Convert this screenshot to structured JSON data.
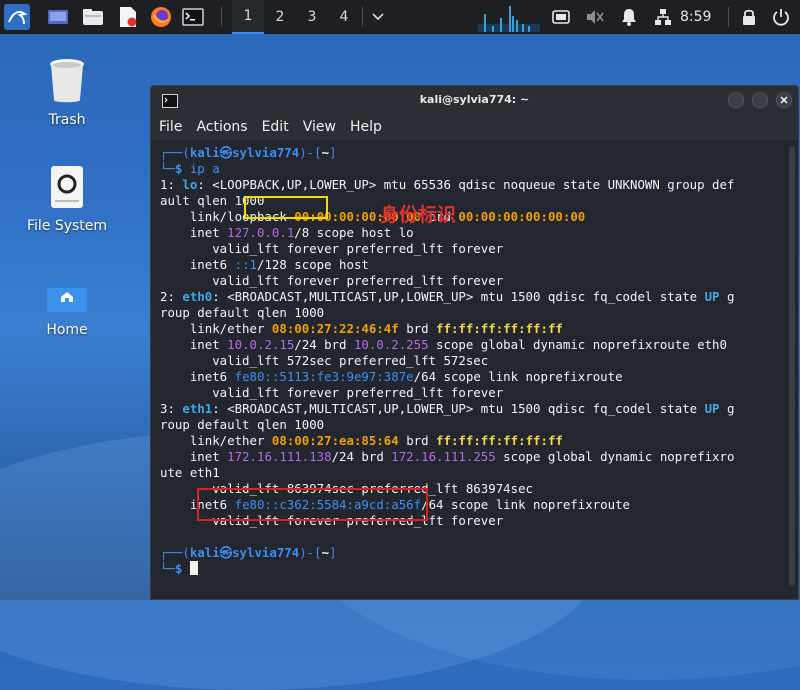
{
  "panel": {
    "workspaces": [
      "1",
      "2",
      "3",
      "4"
    ],
    "clock": "8:59"
  },
  "desktop": {
    "icons": [
      {
        "label": "Trash"
      },
      {
        "label": "File System"
      },
      {
        "label": "Home"
      }
    ]
  },
  "terminal": {
    "title": "kali@sylvia774: ~",
    "menu": [
      "File",
      "Actions",
      "Edit",
      "View",
      "Help"
    ],
    "annotation": "身份标识",
    "prompt_user": "kali",
    "prompt_host": "sylvia774",
    "prompt_dir": "~",
    "command": "ip a",
    "lines": [
      "1: lo: <LOOPBACK,UP,LOWER_UP> mtu 65536 qdisc noqueue state UNKNOWN group def",
      "ault qlen 1000",
      "    link/loopback 00:00:00:00:00:00 brd 00:00:00:00:00:00",
      "    inet 127.0.0.1/8 scope host lo",
      "       valid_lft forever preferred_lft forever",
      "    inet6 ::1/128 scope host",
      "       valid_lft forever preferred_lft forever",
      "2: eth0: <BROADCAST,MULTICAST,UP,LOWER_UP> mtu 1500 qdisc fq_codel state UP g",
      "roup default qlen 1000",
      "    link/ether 08:00:27:22:46:4f brd ff:ff:ff:ff:ff:ff",
      "    inet 10.0.2.15/24 brd 10.0.2.255 scope global dynamic noprefixroute eth0",
      "       valid_lft 572sec preferred_lft 572sec",
      "    inet6 fe80::5113:fe3:9e97:387e/64 scope link noprefixroute",
      "       valid_lft forever preferred_lft forever",
      "3: eth1: <BROADCAST,MULTICAST,UP,LOWER_UP> mtu 1500 qdisc fq_codel state UP g",
      "roup default qlen 1000",
      "    link/ether 08:00:27:ea:85:64 brd ff:ff:ff:ff:ff:ff",
      "    inet 172.16.111.138/24 brd 172.16.111.255 scope global dynamic noprefixro",
      "ute eth1",
      "       valid_lft 863974sec preferred_lft 863974sec",
      "    inet6 fe80::c362:5584:a9cd:a56f/64 scope link noprefixroute",
      "       valid_lft forever preferred_lft forever"
    ]
  },
  "colors": {
    "prompt_blue": "#3b8ff0",
    "ip_magenta": "#b36be6",
    "mac_orange": "#f0a000",
    "broadcast_yellow": "#f3d64b",
    "annotation_red": "#e33030",
    "highlight_yellow": "#f0e000",
    "highlight_red": "#e02020"
  }
}
